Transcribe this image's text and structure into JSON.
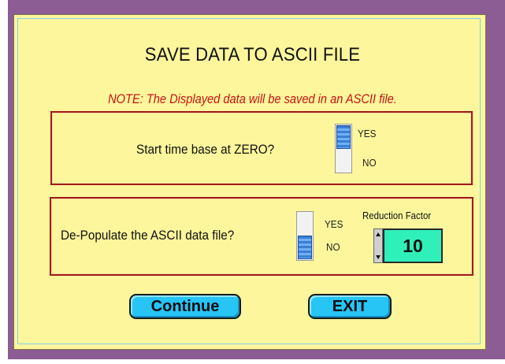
{
  "dialog": {
    "title": "SAVE DATA TO ASCII FILE",
    "note": "NOTE: The Displayed data will be saved in an ASCII file."
  },
  "section1": {
    "question": "Start time base at ZERO?",
    "yes_label": "YES",
    "no_label": "NO",
    "selected": "YES"
  },
  "section2": {
    "question": "De-Populate the ASCII data file?",
    "yes_label": "YES",
    "no_label": "NO",
    "selected": "NO",
    "reduction_label": "Reduction Factor",
    "reduction_value": "10"
  },
  "buttons": {
    "continue_label": "Continue",
    "exit_label": "EXIT"
  },
  "colors": {
    "panel": "#fdf69c",
    "frame": "#8c5c94",
    "section_border": "#a11b1b",
    "note_text": "#c81414",
    "button": "#27c4f6",
    "value_box": "#2ef0b8"
  },
  "icons": [
    "toggle-switch-icon",
    "spinner-arrows-icon"
  ]
}
